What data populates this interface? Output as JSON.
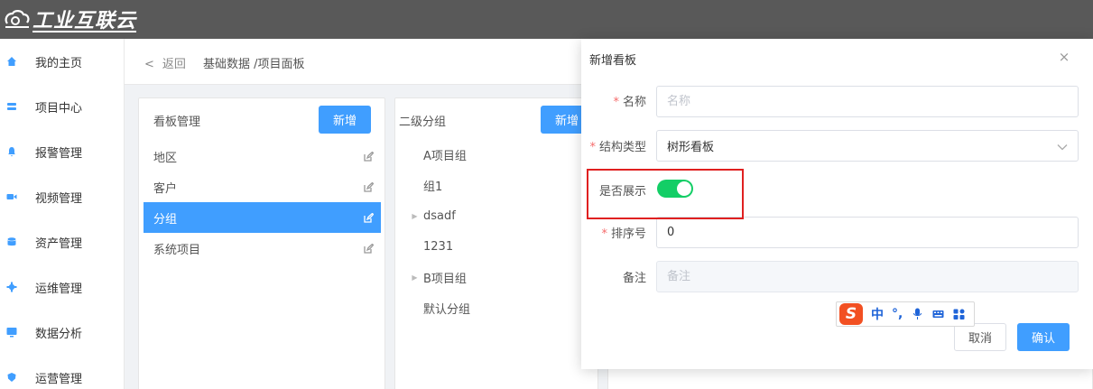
{
  "app": {
    "logo_text": "工业互联云"
  },
  "sidebar": {
    "items": [
      {
        "label": "我的主页",
        "icon": "home-icon"
      },
      {
        "label": "项目中心",
        "icon": "layers-icon"
      },
      {
        "label": "报警管理",
        "icon": "bell-icon"
      },
      {
        "label": "视频管理",
        "icon": "video-icon"
      },
      {
        "label": "资产管理",
        "icon": "database-icon"
      },
      {
        "label": "运维管理",
        "icon": "gear-icon"
      },
      {
        "label": "数据分析",
        "icon": "chart-icon"
      },
      {
        "label": "运营管理",
        "icon": "shield-icon"
      }
    ]
  },
  "header": {
    "back_label": "返回",
    "breadcrumb": "基础数据 /项目面板"
  },
  "board_panel": {
    "title": "看板管理",
    "add_label": "新增",
    "items": [
      {
        "label": "地区",
        "active": false
      },
      {
        "label": "客户",
        "active": false
      },
      {
        "label": "分组",
        "active": true
      },
      {
        "label": "系统项目",
        "active": false
      }
    ]
  },
  "group_panel": {
    "title": "二级分组",
    "add_label": "新增",
    "nodes": [
      {
        "label": "A项目组",
        "expandable": false
      },
      {
        "label": "组1",
        "expandable": false
      },
      {
        "label": "dsadf",
        "expandable": true
      },
      {
        "label": "1231",
        "expandable": false
      },
      {
        "label": "B项目组",
        "expandable": true
      },
      {
        "label": "默认分组",
        "expandable": false
      }
    ]
  },
  "dialog": {
    "title": "新增看板",
    "close_glyph": "×",
    "fields": {
      "name": {
        "label": "名称",
        "required": true,
        "placeholder": "名称",
        "value": ""
      },
      "structure_type": {
        "label": "结构类型",
        "required": true,
        "value": "树形看板"
      },
      "show": {
        "label": "是否展示",
        "value": true,
        "on_color": "#13ce66"
      },
      "sort": {
        "label": "排序号",
        "required": true,
        "value": "0"
      },
      "remark": {
        "label": "备注",
        "placeholder": "备注",
        "value": ""
      }
    },
    "required_mark": "*",
    "cancel_label": "取消",
    "confirm_label": "确认"
  },
  "ime": {
    "logo": "S",
    "mode": "中",
    "punct": "°,"
  },
  "colors": {
    "primary": "#409eff",
    "topbar": "#595959",
    "highlight": "#e02020",
    "switch_on": "#13ce66"
  }
}
